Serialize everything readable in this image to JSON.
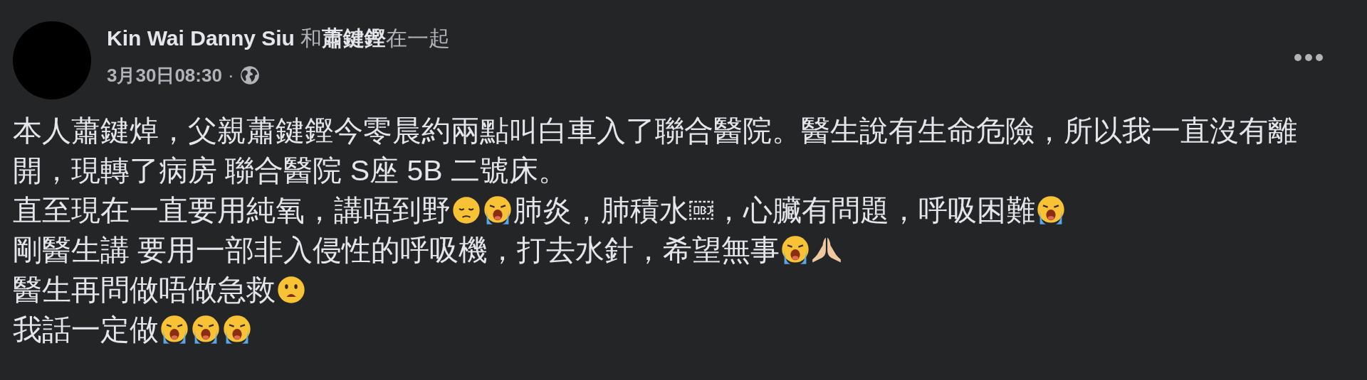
{
  "post": {
    "author": "Kin Wai Danny Siu",
    "with_word": "和",
    "tagged": "蕭鍵鏗",
    "with_suffix": "在一起",
    "time": "3月30日08:30",
    "separator": "·",
    "paragraphs": [
      [
        {
          "kind": "text",
          "text": "本人蕭鍵焯，父親蕭鍵鏗今零晨約兩點叫白車入了聯合醫院。醫生說有生命危險，所以我一直沒有離開，現轉了病房 聯合醫院 S座 5B 二號床。"
        }
      ],
      [
        {
          "kind": "text",
          "text": "直至現在一直要用純氧，講唔到野"
        },
        {
          "kind": "pensive"
        },
        {
          "kind": "crying"
        },
        {
          "kind": "text",
          "text": "肺炎，肺積水"
        },
        {
          "kind": "object"
        },
        {
          "kind": "text",
          "text": "，心臟有問題，呼吸困難"
        },
        {
          "kind": "crying"
        }
      ],
      [
        {
          "kind": "text",
          "text": "剛醫生講 要用一部非入侵性的呼吸機，打去水針，希望無事"
        },
        {
          "kind": "crying"
        },
        {
          "kind": "praying"
        }
      ],
      [
        {
          "kind": "text",
          "text": "醫生再問做唔做急救"
        },
        {
          "kind": "frowning"
        }
      ],
      [
        {
          "kind": "text",
          "text": "我話一定做"
        },
        {
          "kind": "crying"
        },
        {
          "kind": "crying"
        },
        {
          "kind": "crying"
        }
      ]
    ]
  }
}
